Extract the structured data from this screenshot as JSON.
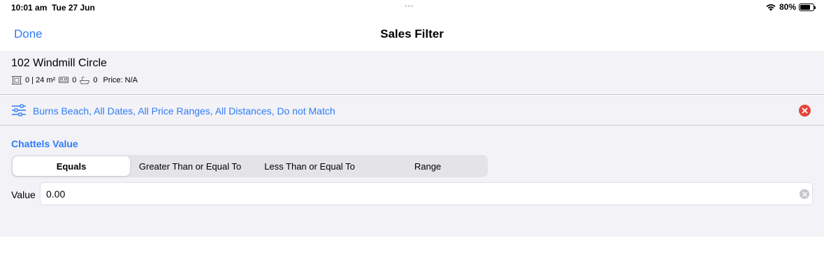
{
  "status_bar": {
    "time": "10:01 am",
    "date": "Tue 27 Jun",
    "battery_percent": "80%",
    "battery_level": 0.8
  },
  "nav": {
    "done_label": "Done",
    "title": "Sales Filter"
  },
  "property": {
    "address": "102 Windmill Circle",
    "land_value": "0 | 24 m²",
    "bedrooms": "0",
    "bathrooms": "0",
    "price": "Price: N/A"
  },
  "filter_summary": {
    "text": "Burns Beach, All Dates, All Price Ranges, All Distances, Do not Match"
  },
  "chattels": {
    "title": "Chattels Value",
    "segments": [
      {
        "label": "Equals",
        "active": true
      },
      {
        "label": "Greater Than or Equal To",
        "active": false
      },
      {
        "label": "Less Than or Equal To",
        "active": false
      },
      {
        "label": "Range",
        "active": false
      }
    ],
    "value_label": "Value",
    "value": "0.00"
  },
  "colors": {
    "accent": "#2f7cf6",
    "clear_red": "#e5443a",
    "background": "#f2f2f7"
  },
  "icons": {
    "wifi": "wifi-icon",
    "battery": "battery-icon",
    "land": "land-area-icon",
    "bed": "bed-icon",
    "bath": "bath-icon",
    "filter": "sliders-icon",
    "clear": "clear-circle-icon"
  }
}
